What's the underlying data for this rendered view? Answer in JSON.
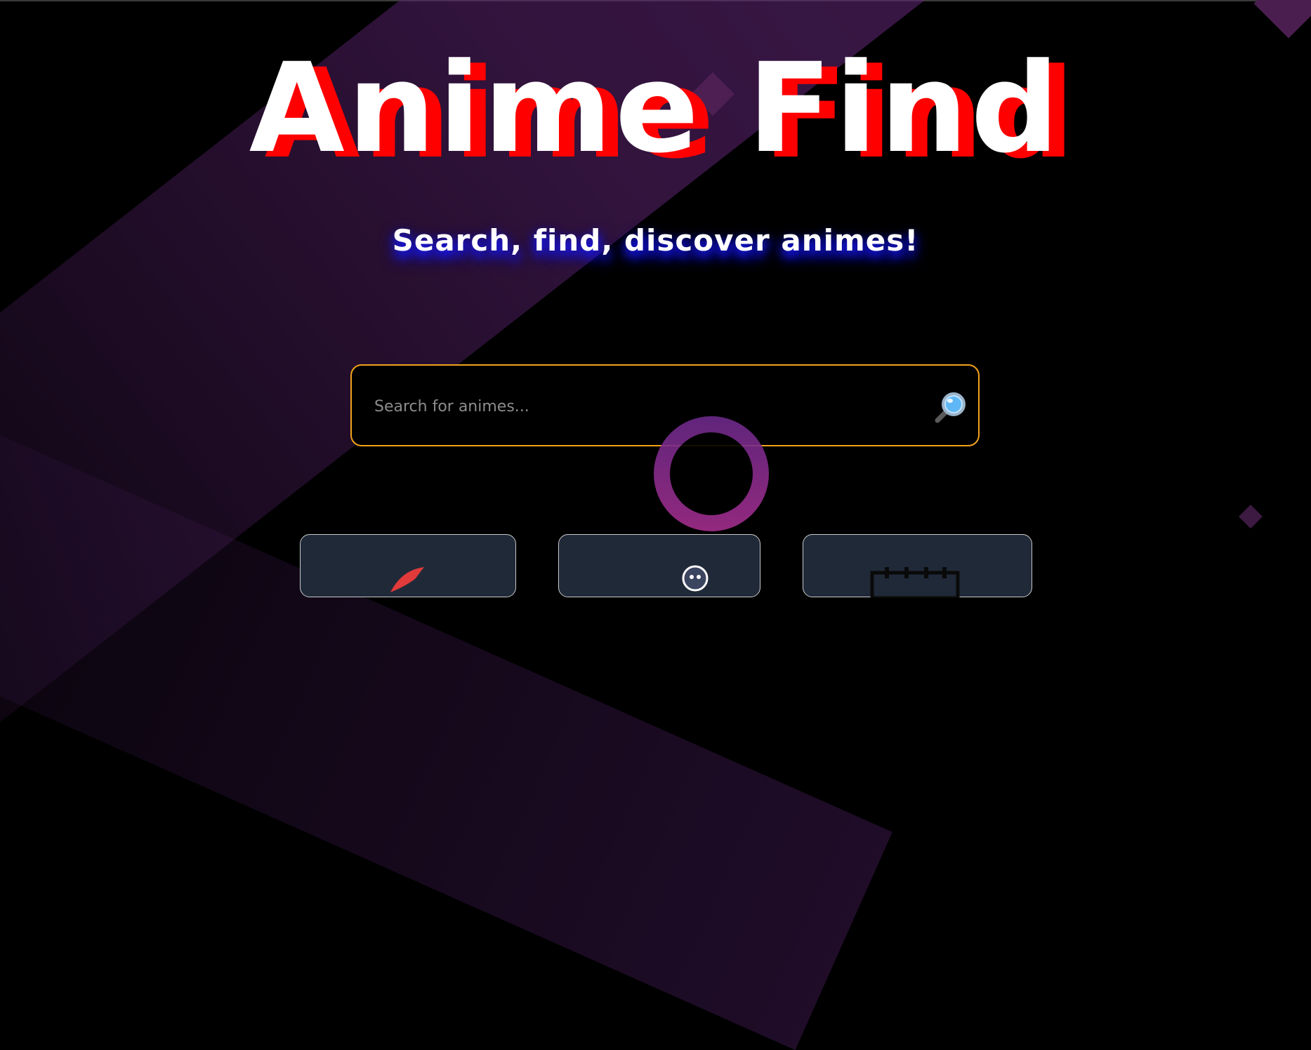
{
  "header": {
    "title": "Anime Find",
    "subtitle": "Search, find, discover animes!"
  },
  "search": {
    "placeholder": "Search for animes...",
    "button_icon": "magnifier-icon"
  },
  "colors": {
    "background": "#000000",
    "title_shadow": "#ff0000",
    "subtitle_glow": "#1a1aff",
    "search_border": "#f2a21b",
    "card_bg": "#202938",
    "accent_purple": "#6b2a8a"
  },
  "cards": [
    {
      "icon": "rocket-icon"
    },
    {
      "icon": "ghost-icon"
    },
    {
      "icon": "calendar-icon"
    }
  ]
}
